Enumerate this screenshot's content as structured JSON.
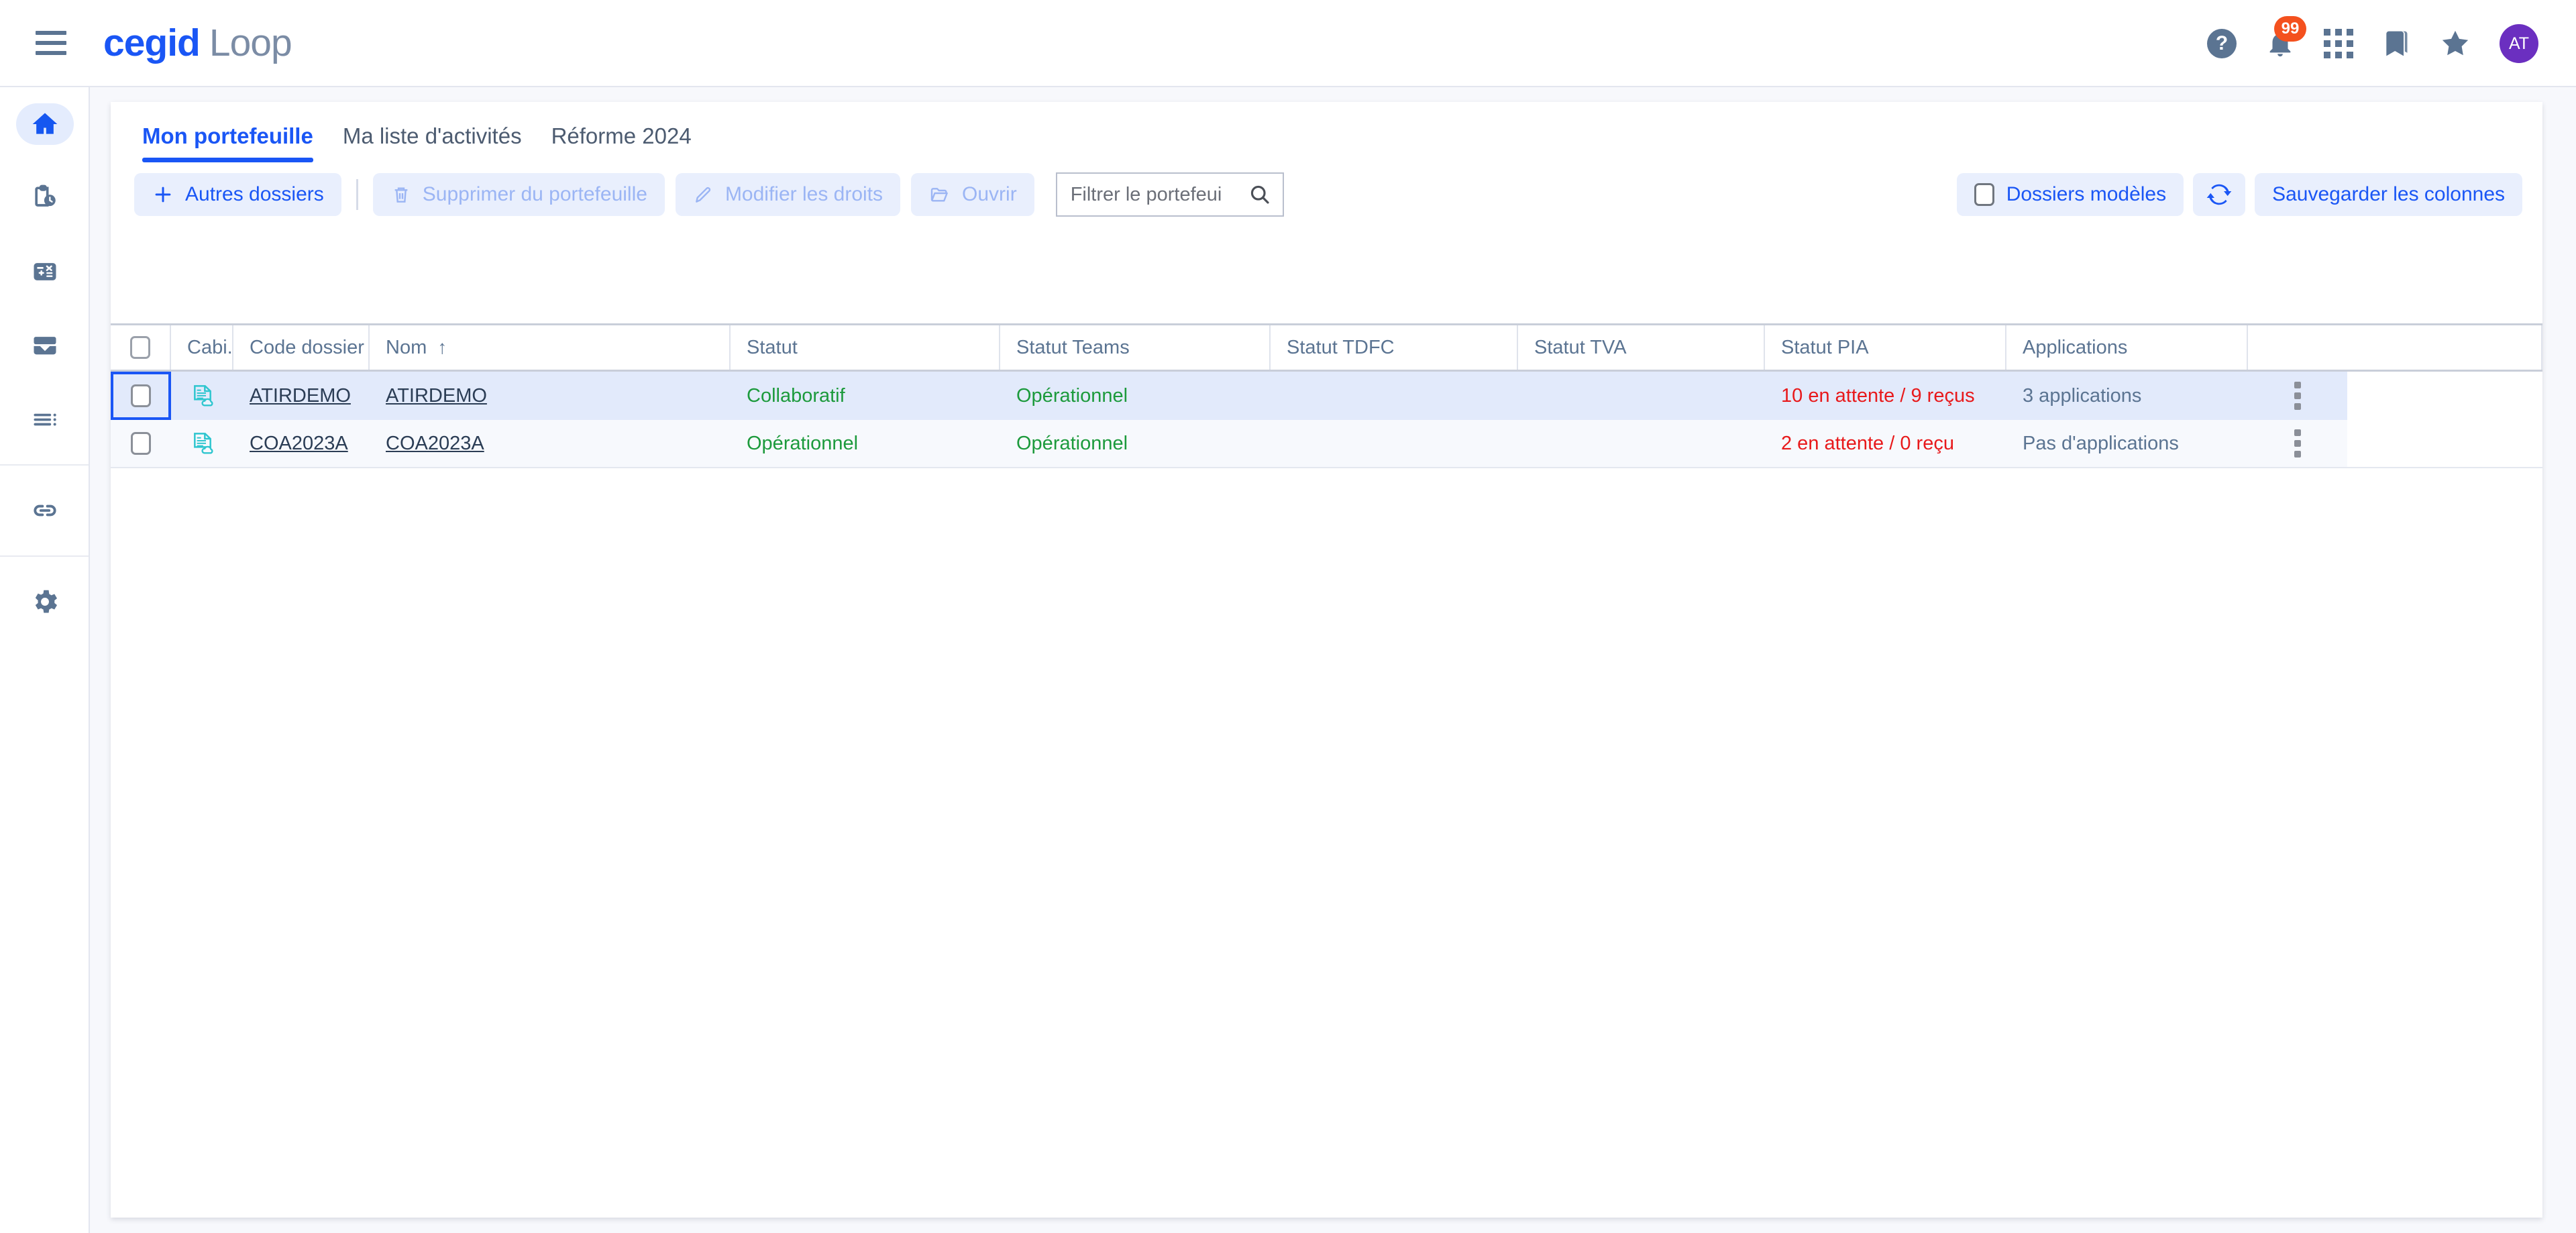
{
  "header": {
    "menu_icon": "hamburger-icon",
    "brand_primary": "cegid",
    "brand_secondary": "Loop",
    "help_label": "?",
    "notification_count": "99",
    "avatar_initials": "AT",
    "icons": [
      "help-icon",
      "bell-icon",
      "apps-grid-icon",
      "bookmark-icon",
      "star-icon"
    ]
  },
  "sidebar": {
    "items": [
      {
        "name": "home",
        "icon": "home-icon",
        "active": true
      },
      {
        "name": "activities",
        "icon": "clipboard-clock-icon",
        "active": false
      },
      {
        "name": "calculator",
        "icon": "calculator-icon",
        "active": false
      },
      {
        "name": "inbox",
        "icon": "inbox-tray-icon",
        "active": false
      },
      {
        "name": "list",
        "icon": "list-icon",
        "active": false
      },
      {
        "name": "links",
        "icon": "link-chain-icon",
        "active": false
      },
      {
        "name": "settings",
        "icon": "gear-icon",
        "active": false
      }
    ]
  },
  "tabs": [
    {
      "label": "Mon portefeuille",
      "active": true
    },
    {
      "label": "Ma liste d'activités",
      "active": false
    },
    {
      "label": "Réforme 2024",
      "active": false
    }
  ],
  "toolbar": {
    "add_folders": "Autres dossiers",
    "delete_from_portfolio": "Supprimer du portefeuille",
    "edit_rights": "Modifier les droits",
    "open": "Ouvrir",
    "search_placeholder": "Filtrer le portefeui",
    "template_folders": "Dossiers modèles",
    "refresh": "refresh-icon",
    "save_columns": "Sauvegarder les colonnes"
  },
  "table": {
    "columns": [
      {
        "key": "check",
        "label": ""
      },
      {
        "key": "cabinet",
        "label": "Cabi..."
      },
      {
        "key": "code",
        "label": "Code dossier"
      },
      {
        "key": "nom",
        "label": "Nom",
        "sorted": "↑"
      },
      {
        "key": "statut",
        "label": "Statut"
      },
      {
        "key": "statut_teams",
        "label": "Statut Teams"
      },
      {
        "key": "statut_tdfc",
        "label": "Statut TDFC"
      },
      {
        "key": "statut_tva",
        "label": "Statut TVA"
      },
      {
        "key": "statut_pia",
        "label": "Statut PIA"
      },
      {
        "key": "applications",
        "label": "Applications"
      },
      {
        "key": "actions",
        "label": ""
      }
    ],
    "rows": [
      {
        "selected": true,
        "doc_icon": "document-cloud-icon",
        "code": "ATIRDEMO",
        "nom": "ATIRDEMO",
        "statut": "Collaboratif",
        "statut_teams": "Opérationnel",
        "statut_tdfc": "",
        "statut_tva": "",
        "statut_pia": "10 en attente / 9 reçus",
        "applications": "3 applications"
      },
      {
        "selected": false,
        "doc_icon": "document-cloud-icon",
        "code": "COA2023A",
        "nom": "COA2023A",
        "statut": "Opérationnel",
        "statut_teams": "Opérationnel",
        "statut_tdfc": "",
        "statut_tva": "",
        "statut_pia": "2 en attente / 0 reçu",
        "applications": "Pas d'applications"
      }
    ]
  },
  "colors": {
    "accent_blue": "#1a56f5",
    "accent_blue_bg": "#e9effd",
    "slate": "#5b7492",
    "status_green": "#1c9a3c",
    "status_red": "#e8191b",
    "badge_orange": "#f4511e",
    "avatar_purple": "#6b2fc0",
    "doc_icon_teal": "#2fc6cf",
    "row_selected_bg": "#e2eafb",
    "page_bg": "#f7f8fc"
  }
}
